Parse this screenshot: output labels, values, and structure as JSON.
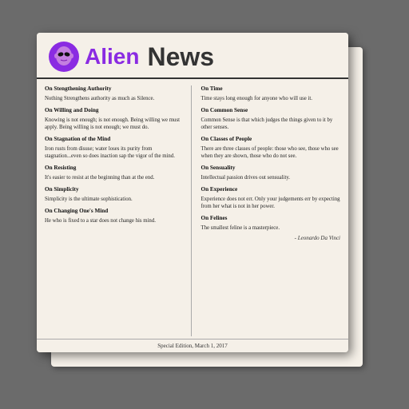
{
  "header": {
    "alien_label": "Alien",
    "news_label": "News"
  },
  "articles_left": [
    {
      "title": "On Stengthening Authority",
      "body": "Nothing Strengthens authority as much as Silence."
    },
    {
      "title": "On Willing and Doing",
      "body": "Knowing is not enough; is not enough. Being willing we must apply. Being willing is not enough; we must do."
    },
    {
      "title": "On Stagnation of the Mind",
      "body": "Iron rusts from disuse; water loses its purity from stagnation...even so does inaction sap the vigor of the mind."
    },
    {
      "title": "On Resisting",
      "body": "It's easier to resist at the beginning than at the end."
    },
    {
      "title": "On Simplicity",
      "body": "Simplicity is the ultimate sophistication."
    },
    {
      "title": "On Changing One's Mind",
      "body": "He who is fixed to a star does not change his mind."
    }
  ],
  "articles_right": [
    {
      "title": "On Time",
      "body": "Time stays long enough for anyone who will use it."
    },
    {
      "title": "On Common Sense",
      "body": "Common Sense is that which judges the things given to it by other senses."
    },
    {
      "title": "On Classes of People",
      "body": "There are three classes of people: those who see, those who see when they are shown, those who do not see."
    },
    {
      "title": "On Sensuality",
      "body": "Intellectual passion drives out sensuality."
    },
    {
      "title": "On Experience",
      "body": "Experience does not err. Only your judgements err by expecting from her what is not in her power."
    },
    {
      "title": "On Felines",
      "body": "The smallest feline is a masterpiece."
    }
  ],
  "attribution": "- Leonardo Da Vinci",
  "footer": "Special Edition, March 1, 2017",
  "accent_color": "#8a2be2"
}
